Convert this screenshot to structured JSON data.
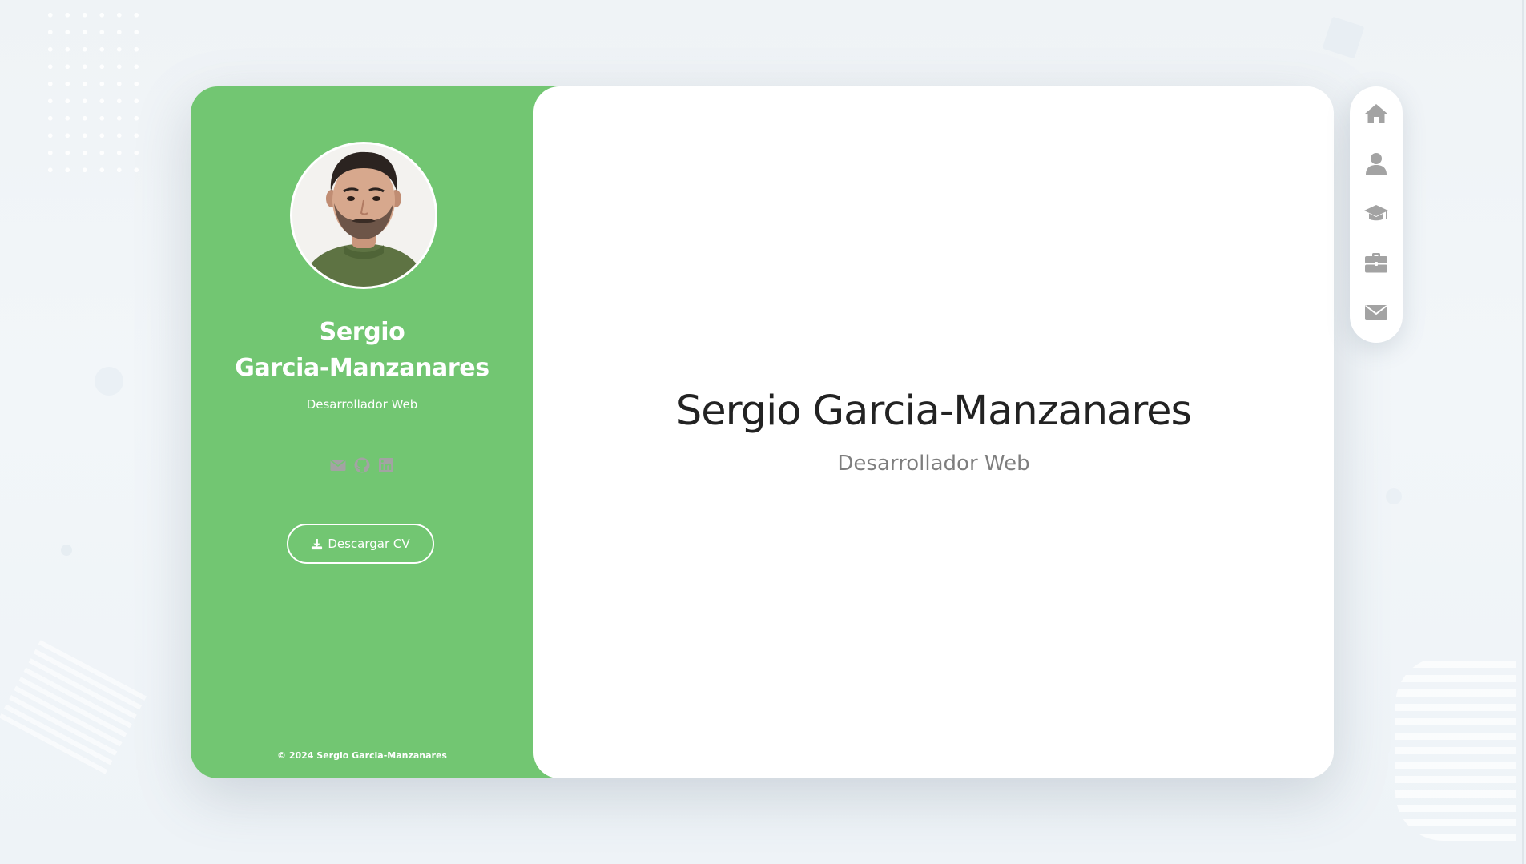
{
  "colors": {
    "accent": "#72c672",
    "icon_gray": "#a3a3a3",
    "background": "#f0f4f7"
  },
  "sidebar": {
    "avatar_alt": "Sergio Garcia-Manzanares",
    "name_line1": "Sergio",
    "name_line2": "Garcia-Manzanares",
    "role": "Desarrollador Web",
    "socials": [
      {
        "icon": "envelope-icon"
      },
      {
        "icon": "github-icon"
      },
      {
        "icon": "linkedin-icon"
      }
    ],
    "cv_button_label": "Descargar CV",
    "cv_button_icon": "download-icon",
    "copyright": "© 2024 Sergio Garcia-Manzanares"
  },
  "main": {
    "title": "Sergio Garcia-Manzanares",
    "subtitle": "Desarrollador Web"
  },
  "nav": {
    "items": [
      {
        "icon": "home-icon"
      },
      {
        "icon": "user-icon"
      },
      {
        "icon": "graduation-cap-icon"
      },
      {
        "icon": "briefcase-icon"
      },
      {
        "icon": "envelope-icon"
      }
    ]
  }
}
